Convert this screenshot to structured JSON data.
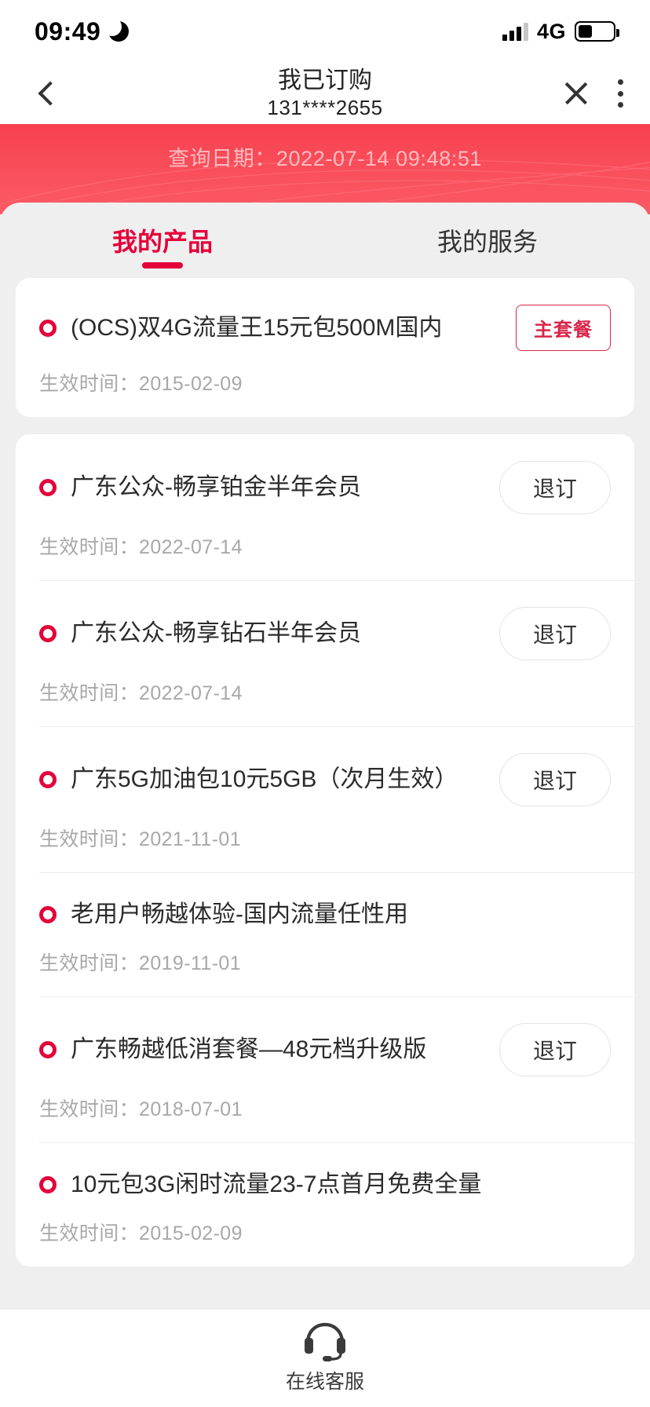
{
  "status_bar": {
    "time": "09:49",
    "moon_icon": "crescent-moon-icon",
    "network": "4G",
    "signal_bars_total": 4,
    "signal_bars_filled": 3,
    "battery_percent": 40
  },
  "nav": {
    "back_icon": "chevron-left-icon",
    "title": "我已订购",
    "subtitle": "131****2655",
    "close_icon": "close-icon",
    "more_icon": "kebab-menu-icon"
  },
  "banner": {
    "text": "查询日期：2022-07-14 09:48:51",
    "color": "#f8404f",
    "text_color": "#ffbcc0"
  },
  "tabs": [
    {
      "label": "我的产品",
      "active": true
    },
    {
      "label": "我的服务",
      "active": false
    }
  ],
  "labels": {
    "effective_prefix": "生效时间："
  },
  "groups": [
    {
      "items": [
        {
          "title": "(OCS)双4G流量王15元包500M国内",
          "effective_time": "2015-02-09",
          "action": "主套餐",
          "action_type": "badge"
        }
      ]
    },
    {
      "items": [
        {
          "title": "广东公众-畅享铂金半年会员",
          "effective_time": "2022-07-14",
          "action": "退订",
          "action_type": "button"
        },
        {
          "title": "广东公众-畅享钻石半年会员",
          "effective_time": "2022-07-14",
          "action": "退订",
          "action_type": "button"
        },
        {
          "title": "广东5G加油包10元5GB（次月生效）",
          "effective_time": "2021-11-01",
          "action": "退订",
          "action_type": "button"
        },
        {
          "title": "老用户畅越体验-国内流量任性用",
          "effective_time": "2019-11-01",
          "action": "",
          "action_type": "none"
        },
        {
          "title": "广东畅越低消套餐—48元档升级版",
          "effective_time": "2018-07-01",
          "action": "退订",
          "action_type": "button"
        },
        {
          "title": "10元包3G闲时流量23-7点首月免费全量",
          "effective_time": "2015-02-09",
          "action": "",
          "action_type": "none"
        }
      ]
    }
  ],
  "bottom_bar": {
    "icon": "headset-icon",
    "label": "在线客服"
  }
}
